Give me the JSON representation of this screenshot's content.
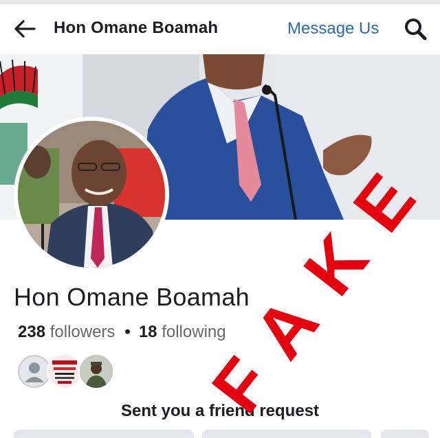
{
  "header": {
    "title": "Hon Omane Boamah",
    "message_label": "Message Us",
    "back_icon": "arrow-left-icon",
    "search_icon": "search-icon"
  },
  "profile": {
    "name": "Hon Omane Boamah",
    "followers_count": "238",
    "followers_label": "followers",
    "following_count": "18",
    "following_label": "following",
    "separator": "•"
  },
  "mutual_friends": [
    {
      "type": "default-avatar-icon"
    },
    {
      "type": "poster-thumbnail"
    },
    {
      "type": "person-thumbnail"
    }
  ],
  "request": {
    "text": "Sent you a friend request"
  },
  "overlay": {
    "stamp_text": "FAKE",
    "stamp_color": "#e3000f"
  },
  "colors": {
    "link": "#2d6aa8",
    "text": "#1c1e21",
    "muted": "#65676b"
  }
}
